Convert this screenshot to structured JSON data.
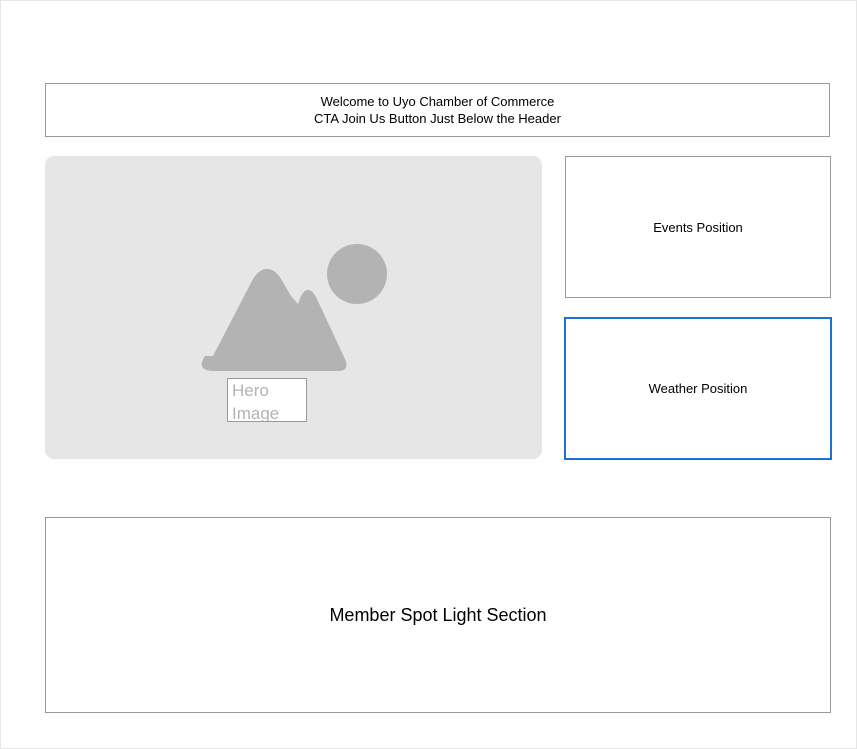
{
  "header": {
    "line1": "Welcome to Uyo Chamber of Commerce",
    "line2": "CTA Join Us Button Just Below the Header"
  },
  "hero": {
    "label": "Hero Image",
    "icon": "image-placeholder-icon"
  },
  "events": {
    "label": "Events Position"
  },
  "weather": {
    "label": "Weather Position"
  },
  "spotlight": {
    "label": "Member Spot Light Section"
  },
  "colors": {
    "placeholder_bg": "#e6e6e6",
    "placeholder_icon": "#b3b3b3",
    "border_gray": "#9a9a9a",
    "selected_blue": "#1f6fd6"
  }
}
